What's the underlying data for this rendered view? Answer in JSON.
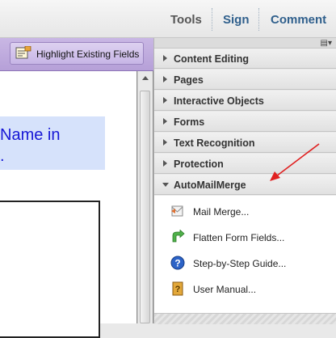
{
  "toolbar": {
    "tools_label": "Tools",
    "sign_label": "Sign",
    "comment_label": "Comment"
  },
  "form_bar": {
    "highlight_label": "Highlight Existing Fields"
  },
  "document": {
    "line1": "Name in",
    "line2": "."
  },
  "panel": {
    "sections": [
      {
        "label": "Content Editing"
      },
      {
        "label": "Pages"
      },
      {
        "label": "Interactive Objects"
      },
      {
        "label": "Forms"
      },
      {
        "label": "Text Recognition"
      },
      {
        "label": "Protection"
      },
      {
        "label": "AutoMailMerge"
      }
    ],
    "automailmerge_items": [
      {
        "label": "Mail Merge...",
        "icon": "mail-merge-icon"
      },
      {
        "label": "Flatten Form Fields...",
        "icon": "flatten-icon"
      },
      {
        "label": "Step-by-Step Guide...",
        "icon": "help-icon"
      },
      {
        "label": "User Manual...",
        "icon": "manual-icon"
      }
    ]
  },
  "colors": {
    "form_bar": "#c1aee0",
    "document_text": "#1717d6",
    "annotation_arrow": "#e02020"
  }
}
